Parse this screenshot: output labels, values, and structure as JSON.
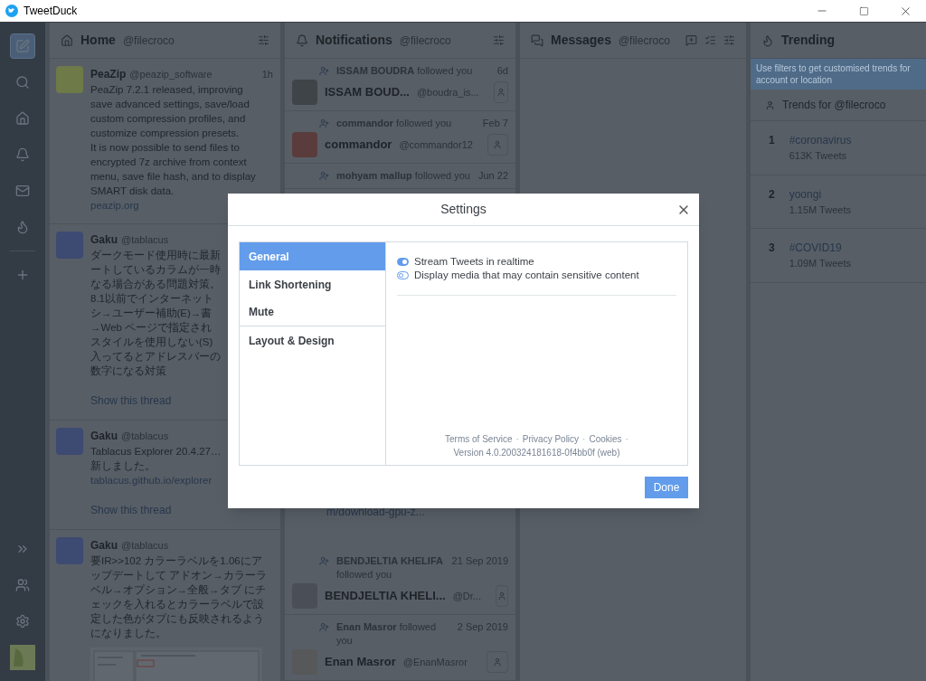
{
  "window": {
    "title": "TweetDuck"
  },
  "home": {
    "title": "Home",
    "handle": "@filecroco",
    "tweets": [
      {
        "kind": "text",
        "name": "PeaZip",
        "handle": "@peazip_software",
        "time": "1h",
        "lines": [
          "PeaZip 7.2.1 released, improving",
          "save advanced settings, save/load",
          "custom compression profiles, and",
          "customize compression presets.",
          "It is now possible to send files to",
          "encrypted 7z archive from context",
          "menu, save file hash, and to display",
          "SMART disk data."
        ],
        "link": "peazip.org"
      },
      {
        "kind": "text",
        "name": "Gaku",
        "handle": "@tablacus",
        "lines": [
          "ダークモード使用時に最新",
          "ートしているカラムが一時",
          "なる場合がある問題対策。",
          "8.1以前でインターネット",
          "シ→ユーザー補助(E)→書",
          "→Web ページで指定され",
          "スタイルを使用しない(S)",
          "入ってるとアドレスバーの",
          "数字になる対策"
        ],
        "thread": "Show this thread"
      },
      {
        "kind": "text",
        "name": "Gaku",
        "handle": "@tablacus",
        "lines": [
          "Tablacus Explorer 20.4.27…",
          "新しました。"
        ],
        "link": "tablacus.github.io/explorer",
        "thread": "Show this thread"
      },
      {
        "name": "Gaku",
        "handle": "@tablacus",
        "lines": [
          "要IR>>102 カラーラベルを1.06にア",
          "ップデートして アドオン→カラーラ",
          "ベル→オプション→全般→タブ にチ",
          "ェックを入れるとカラーラベルで設",
          "定した色がタブにも反映されるよう",
          "になりました。"
        ]
      }
    ]
  },
  "notifications": {
    "title": "Notifications",
    "handle": "@filecroco",
    "top": [
      {
        "who": "ISSAM BOUDRA",
        "action": "followed you",
        "time": "6d",
        "name": "ISSAM BOUD...",
        "handle": "@boudra_is..."
      },
      {
        "who": "commandor",
        "action": "followed you",
        "time": "Feb 7",
        "name": "commandor",
        "handle": "@commandor12"
      },
      {
        "who": "mohyam mallup",
        "action": "followed you",
        "time": "Jun 22"
      }
    ],
    "cut_text": "m/download-gpu-z...",
    "bottom": [
      {
        "who": "BENDJELTIA KHELIFA",
        "action": "followed you",
        "time": "21 Sep 2019",
        "name": "BENDJELTIA KHELI...",
        "handle": "@Dr..."
      },
      {
        "who": "Enan Masror",
        "action": "followed you",
        "time": "2 Sep 2019",
        "name": "Enan Masror",
        "handle": "@EnanMasror"
      }
    ]
  },
  "messages": {
    "title": "Messages",
    "handle": "@filecroco"
  },
  "trending": {
    "title": "Trending",
    "banner": [
      "Use filters to get customised trends for",
      "account or location"
    ],
    "trends_for": "Trends for @filecroco",
    "items": [
      {
        "rank": "1",
        "tag": "#coronavirus",
        "count": "613K Tweets"
      },
      {
        "rank": "2",
        "tag": "yoongi",
        "count": "1.15M Tweets"
      },
      {
        "rank": "3",
        "tag": "#COVID19",
        "count": "1.09M Tweets"
      }
    ]
  },
  "settings": {
    "title": "Settings",
    "sections": [
      {
        "label": "General",
        "selected": true
      },
      {
        "label": "Link Shortening",
        "selected": false
      },
      {
        "label": "Mute",
        "selected": false
      },
      {
        "label": "Layout & Design",
        "selected": false
      }
    ],
    "options": [
      {
        "label": "Stream Tweets in realtime",
        "on": true
      },
      {
        "label": "Display media that may contain sensitive content",
        "on": false
      }
    ],
    "footer": [
      {
        "kind": "link",
        "text": "Terms of Service"
      },
      {
        "kind": "separator",
        "text": "·"
      },
      {
        "kind": "link",
        "text": "Privacy Policy"
      },
      {
        "kind": "separator",
        "text": "·"
      },
      {
        "kind": "link",
        "text": "Cookies"
      },
      {
        "kind": "separator",
        "text": "·"
      }
    ],
    "version": "Version 4.0.200324181618-0f4bb0f (web)",
    "done": "Done"
  }
}
